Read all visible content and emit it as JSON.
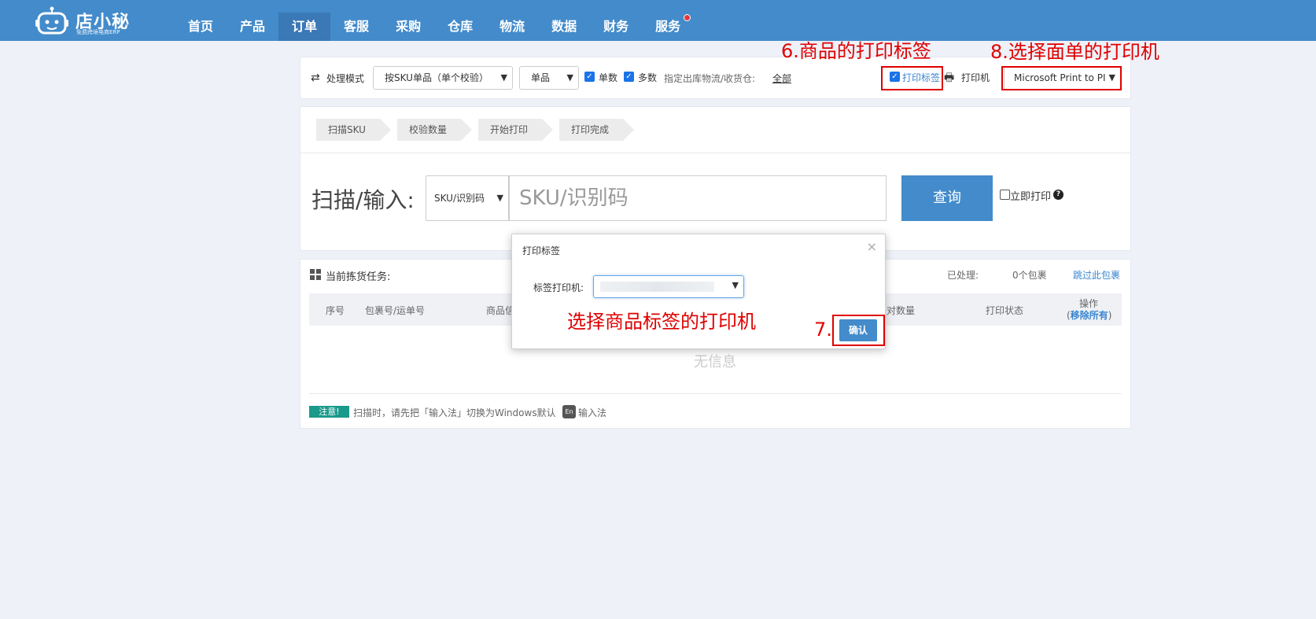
{
  "brand": {
    "name": "店小秘",
    "tagline": "免费跨境电商ERP"
  },
  "nav": {
    "items": [
      {
        "label": "首页"
      },
      {
        "label": "产品"
      },
      {
        "label": "订单",
        "active": true
      },
      {
        "label": "客服"
      },
      {
        "label": "采购"
      },
      {
        "label": "仓库"
      },
      {
        "label": "物流"
      },
      {
        "label": "数据"
      },
      {
        "label": "财务"
      },
      {
        "label": "服务",
        "has_dot": true
      }
    ]
  },
  "toolbar": {
    "mode_label": "处理模式",
    "mode_select": "按SKU单品（单个校验）",
    "type_select": "单品",
    "single_count_label": "单数",
    "multi_count_label": "多数",
    "warehouse_label": "指定出库物流/收货仓:",
    "warehouse_link": "全部",
    "print_label_checkbox": "打印标签",
    "printer_label": "打印机",
    "printer_select": "Microsoft Print to PI"
  },
  "steps": [
    "扫描SKU",
    "校验数量",
    "开始打印",
    "打印完成"
  ],
  "scan": {
    "label": "扫描/输入:",
    "type_select": "SKU/识别码",
    "input_placeholder": "SKU/识别码",
    "query_button": "查询",
    "print_now_label": "立即打印",
    "help_icon": "?"
  },
  "task": {
    "title": "当前拣货任务:",
    "processed_label": "已处理:",
    "processed_value": "0个包裹",
    "skip_link": "跳过此包裹",
    "columns": [
      "序号",
      "包裹号/运单号",
      "商品信",
      "对数量",
      "打印状态"
    ],
    "op_label": "操作",
    "remove_all_link": "移除所有",
    "op_paren_open": "(",
    "op_paren_close": ")",
    "empty_text": "无信息",
    "note_badge": "注意!",
    "note_text": "扫描时，请先把「输入法」切换为Windows默认",
    "en_badge": "En",
    "note_suffix": "输入法"
  },
  "modal": {
    "title": "打印标签",
    "close_glyph": "×",
    "field_label": "标签打印机:",
    "ok_button": "确认"
  },
  "annotations": {
    "a6": "6.商品的打印标签",
    "a8": "8.选择面单的打印机",
    "a_select": "选择商品标签的打印机",
    "a7": "7."
  },
  "colors": {
    "nav_bg": "#438bcb",
    "annotation_red": "#e00000",
    "page_bg": "#eef1f8"
  }
}
